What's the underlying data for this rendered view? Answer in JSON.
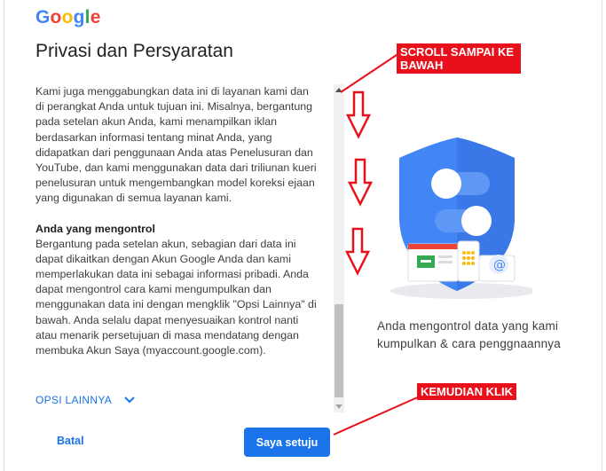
{
  "logo": [
    "G",
    "o",
    "o",
    "g",
    "l",
    "e"
  ],
  "logo_colors": [
    "#4285F4",
    "#EA4335",
    "#FBBC05",
    "#4285F4",
    "#34A853",
    "#EA4335"
  ],
  "title": "Privasi dan Persyaratan",
  "body": {
    "para1": "Kami juga menggabungkan data ini di layanan kami dan di perangkat Anda untuk tujuan ini. Misalnya, bergantung pada setelan akun Anda, kami menampilkan iklan berdasarkan informasi tentang minat Anda, yang didapatkan dari penggunaan Anda atas Penelusuran dan YouTube, dan kami menggunakan data dari triliunan kueri penelusuran untuk mengembangkan model koreksi ejaan yang digunakan di semua layanan kami.",
    "heading2": "Anda yang mengontrol",
    "para2": "Bergantung pada setelan akun, sebagian dari data ini dapat dikaitkan dengan Akun Google Anda dan kami memperlakukan data ini sebagai informasi pribadi. Anda dapat mengontrol cara kami mengumpulkan dan menggunakan data ini dengan mengklik \"Opsi Lainnya\" di bawah. Anda selalu dapat menyesuaikan kontrol nanti atau menarik persetujuan di masa mendatang dengan membuka Akun Saya (myaccount.google.com)."
  },
  "more_options": "OPSI LAINNYA",
  "cancel_label": "Batal",
  "agree_label": "Saya setuju",
  "caption": "Anda mengontrol data yang kami kumpulkan & cara penggnaannya",
  "annotations": {
    "scroll_note": "SCROLL SAMPAI KE BAWAH",
    "click_note": "KEMUDIAN KLIK"
  },
  "colors": {
    "accent": "#1a73e8",
    "annotation_red": "#e8101b",
    "shield": "#4285F4"
  },
  "icons": [
    "shield-icon",
    "chevron-down-icon",
    "down-arrow-icon",
    "at-sign-icon"
  ]
}
